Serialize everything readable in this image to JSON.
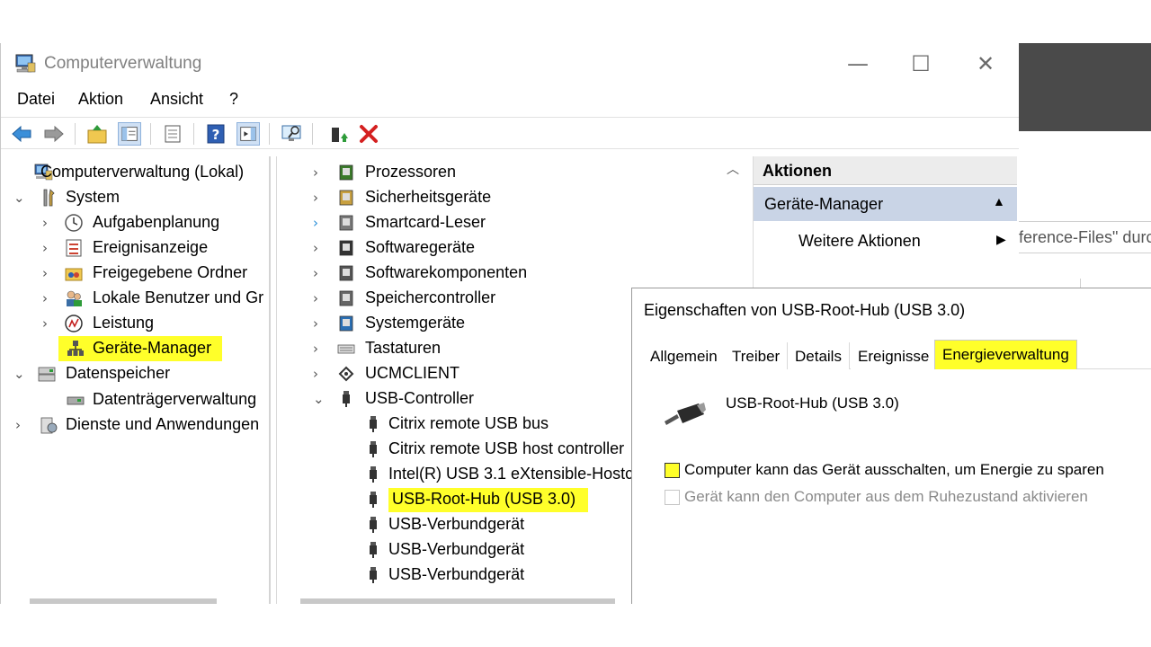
{
  "window": {
    "title": "Computerverwaltung",
    "controls": {
      "minimize": "—",
      "maximize": "☐",
      "close": "✕"
    }
  },
  "menu": [
    "Datei",
    "Aktion",
    "Ansicht",
    "?"
  ],
  "tree": {
    "root": "Computerverwaltung (Lokal)",
    "system": "System",
    "system_items": [
      "Aufgabenplanung",
      "Ereignisanzeige",
      "Freigegebene Ordner",
      "Lokale Benutzer und Gr",
      "Leistung",
      "Geräte-Manager"
    ],
    "datenspeicher": "Datenspeicher",
    "datentraeger": "Datenträgerverwaltung",
    "dienste": "Dienste und Anwendungen"
  },
  "devices": {
    "categories": [
      "Prozessoren",
      "Sicherheitsgeräte",
      "Smartcard-Leser",
      "Softwaregeräte",
      "Softwarekomponenten",
      "Speichercontroller",
      "Systemgeräte",
      "Tastaturen",
      "UCMCLIENT",
      "USB-Controller"
    ],
    "usb_children": [
      "Citrix remote USB bus",
      "Citrix remote USB host controller",
      "Intel(R) USB 3.1 eXtensible-Hostc",
      "USB-Root-Hub (USB 3.0)",
      "USB-Verbundgerät",
      "USB-Verbundgerät",
      "USB-Verbundgerät"
    ]
  },
  "actions": {
    "header": "Aktionen",
    "section": "Geräte-Manager",
    "more": "Weitere Aktionen"
  },
  "background_window": {
    "text": "ference-Files\" durc"
  },
  "dialog": {
    "title": "Eigenschaften von USB-Root-Hub (USB 3.0)",
    "tabs": [
      "Allgemein",
      "Treiber",
      "Details",
      "Ereignisse",
      "Energieverwaltung"
    ],
    "active_tab": "Energieverwaltung",
    "device_name": "USB-Root-Hub (USB 3.0)",
    "option1": {
      "label": "Computer kann das Gerät ausschalten, um Energie zu sparen",
      "checked": false,
      "enabled": true
    },
    "option2": {
      "label": "Gerät kann den Computer aus dem Ruhezustand aktivieren",
      "checked": false,
      "enabled": false
    }
  },
  "colors": {
    "highlight": "#ffff2a",
    "actions_sub_bg": "#c9d4e6",
    "title_gray": "#808080"
  },
  "icons": {
    "back": "arrow-left-icon",
    "forward": "arrow-right-icon",
    "close_red": "red-x-icon"
  }
}
